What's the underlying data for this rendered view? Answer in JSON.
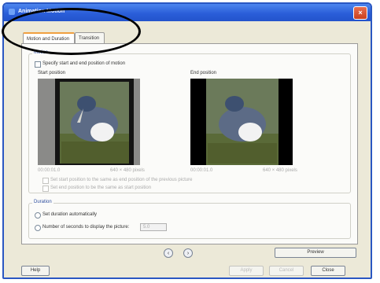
{
  "window": {
    "title": "Animation Motion",
    "close_icon": "×"
  },
  "tabs": [
    {
      "label": "Motion and Duration"
    },
    {
      "label": "Transition"
    }
  ],
  "motion": {
    "group_label": "Motion",
    "specify_checkbox": "Specify start and end position of motion",
    "start_label": "Start position",
    "end_label": "End position",
    "start_time": "00:00:01.0",
    "start_size": "640 × 480 pixels",
    "end_time": "00:00:01.0",
    "end_size": "640 × 480 pixels",
    "option1": "Set start position to the same as end position of the previous picture",
    "option2": "Set end position to be the same as start position"
  },
  "duration": {
    "group_label": "Duration",
    "radio1": "Set duration automatically",
    "radio2": "Number of seconds to display the picture:",
    "seconds_value": "5.0"
  },
  "nav": {
    "prev_icon": "‹",
    "next_icon": "›"
  },
  "buttons": {
    "preview": "Preview",
    "help": "Help",
    "apply": "Apply",
    "cancel": "Cancel",
    "close": "Close"
  },
  "colors": {
    "title_bar": "#2a5ed9",
    "tab_active": "#f0a040"
  }
}
